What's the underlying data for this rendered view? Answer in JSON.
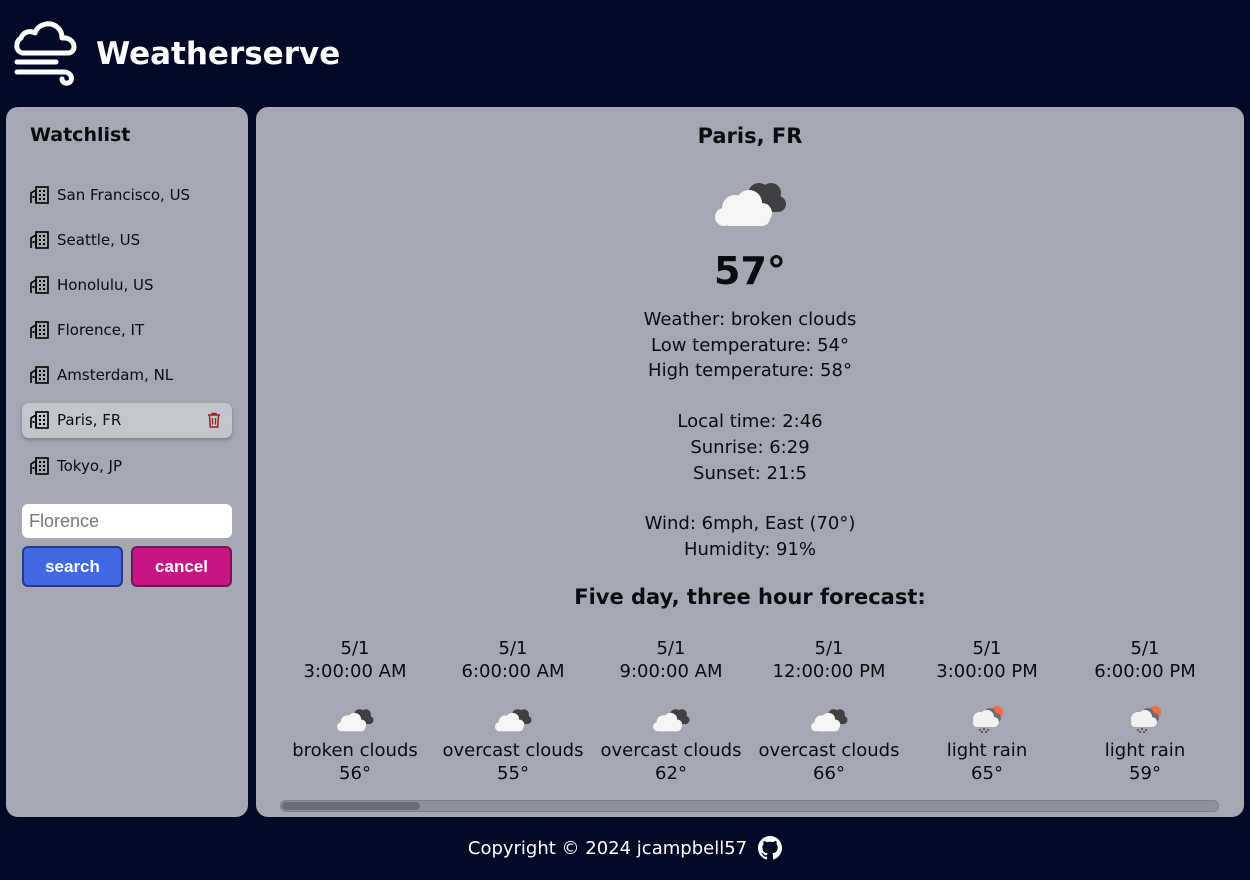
{
  "app": {
    "title": "Weatherserve"
  },
  "sidebar": {
    "title": "Watchlist",
    "items": [
      {
        "label": "San Francisco, US"
      },
      {
        "label": "Seattle, US"
      },
      {
        "label": "Honolulu, US"
      },
      {
        "label": "Florence, IT"
      },
      {
        "label": "Amsterdam, NL"
      },
      {
        "label": "Paris, FR",
        "selected": true
      },
      {
        "label": "Tokyo, JP"
      }
    ],
    "search": {
      "placeholder": "Florence",
      "value": ""
    },
    "search_label": "search",
    "cancel_label": "cancel"
  },
  "current": {
    "city": "Paris, FR",
    "icon": "broken-clouds-icon",
    "temp": "57°",
    "weather": "Weather: broken clouds",
    "low": "Low temperature: 54°",
    "high": "High temperature: 58°",
    "local_time": "Local time: 2:46",
    "sunrise": "Sunrise: 6:29",
    "sunset": "Sunset: 21:5",
    "wind": "Wind: 6mph, East (70°)",
    "humidity": "Humidity: 91%"
  },
  "forecast": {
    "title": "Five day, three hour forecast:",
    "items": [
      {
        "date": "5/1",
        "time": "3:00:00 AM",
        "desc": "broken clouds",
        "temp": "56°",
        "icon": "broken-clouds-icon"
      },
      {
        "date": "5/1",
        "time": "6:00:00 AM",
        "desc": "overcast clouds",
        "temp": "55°",
        "icon": "overcast-clouds-icon"
      },
      {
        "date": "5/1",
        "time": "9:00:00 AM",
        "desc": "overcast clouds",
        "temp": "62°",
        "icon": "overcast-clouds-icon"
      },
      {
        "date": "5/1",
        "time": "12:00:00 PM",
        "desc": "overcast clouds",
        "temp": "66°",
        "icon": "overcast-clouds-icon"
      },
      {
        "date": "5/1",
        "time": "3:00:00 PM",
        "desc": "light rain",
        "temp": "65°",
        "icon": "light-rain-icon"
      },
      {
        "date": "5/1",
        "time": "6:00:00 PM",
        "desc": "light rain",
        "temp": "59°",
        "icon": "light-rain-icon"
      }
    ]
  },
  "footer": {
    "copyright": "Copyright © 2024 jcampbell57",
    "icon": "github-icon"
  },
  "colors": {
    "background": "#000a26",
    "panel": "#a5a7b2",
    "search_button": "#4169e1",
    "cancel_button": "#c71585",
    "delete_icon": "#b01818"
  }
}
